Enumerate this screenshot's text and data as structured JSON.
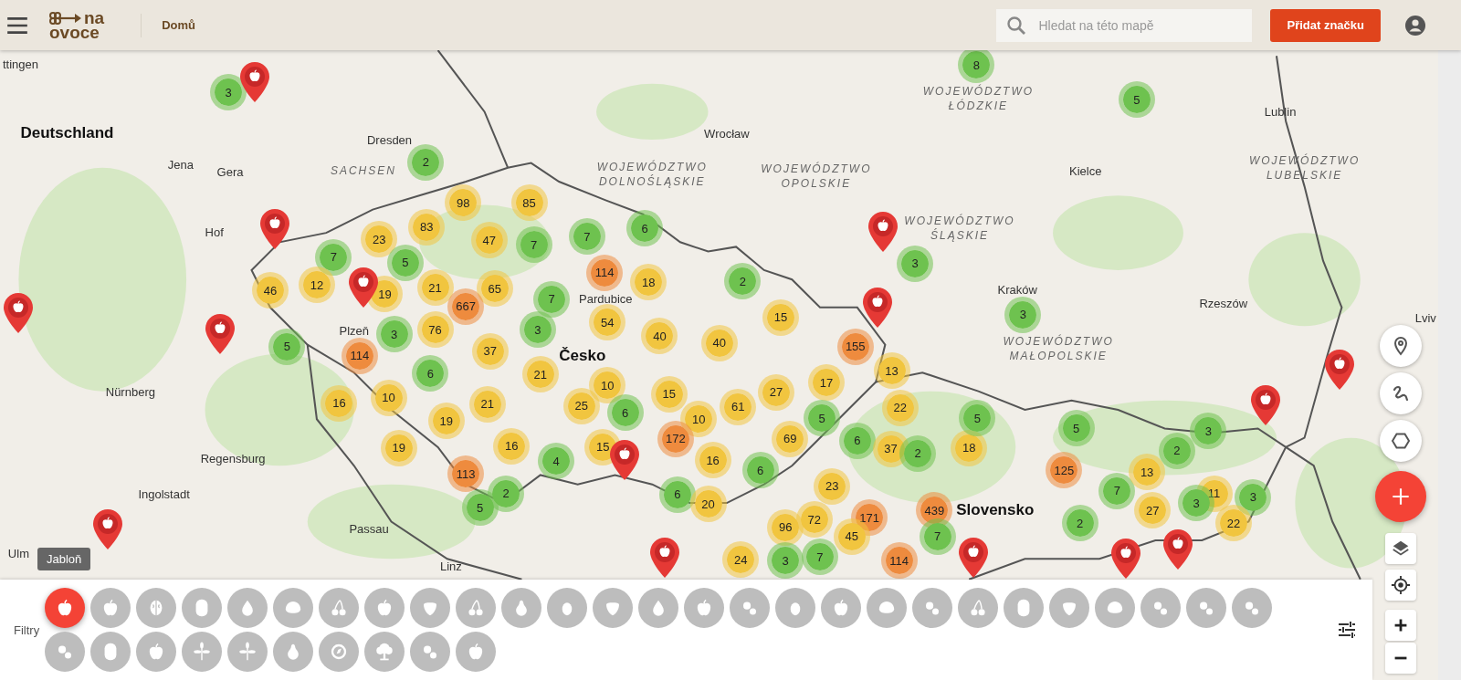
{
  "header": {
    "logo_lines": [
      "na",
      "ovoce"
    ],
    "nav_link": "Domů",
    "search": {
      "placeholder": "Hledat na této mapě"
    },
    "add_button": "Přidat značku"
  },
  "places": [
    {
      "name": "ttingen",
      "kind": "city"
    },
    {
      "name": "Deutschland",
      "kind": "country"
    },
    {
      "name": "Jena",
      "kind": "city"
    },
    {
      "name": "Gera",
      "kind": "city"
    },
    {
      "name": "Dresden",
      "kind": "city"
    },
    {
      "name": "SACHSEN",
      "kind": "region"
    },
    {
      "name": "Hof",
      "kind": "city"
    },
    {
      "name": "Nürnberg",
      "kind": "city"
    },
    {
      "name": "Regensburg",
      "kind": "city"
    },
    {
      "name": "Ingolstadt",
      "kind": "city"
    },
    {
      "name": "Passau",
      "kind": "city"
    },
    {
      "name": "Linz",
      "kind": "city"
    },
    {
      "name": "Ulm",
      "kind": "city"
    },
    {
      "name": "Wrocław",
      "kind": "city"
    },
    {
      "name": "WOJEWÓDZTWO DOLNOŚLĄSKIE",
      "kind": "region"
    },
    {
      "name": "WOJEWÓDZTWO OPOLSKIE",
      "kind": "region"
    },
    {
      "name": "WOJEWÓDZTWO ŁÓDZKIE",
      "kind": "region"
    },
    {
      "name": "WOJEWÓDZTWO ŚLĄSKIE",
      "kind": "region"
    },
    {
      "name": "Kraków",
      "kind": "city"
    },
    {
      "name": "Kielce",
      "kind": "city"
    },
    {
      "name": "Lublin",
      "kind": "city"
    },
    {
      "name": "WOJEWÓDZTWO LUBELSKIE",
      "kind": "region"
    },
    {
      "name": "Rzeszów",
      "kind": "city"
    },
    {
      "name": "WOJEWÓDZTWO MAŁOPOLSKIE",
      "kind": "region"
    },
    {
      "name": "Lviv",
      "kind": "city"
    },
    {
      "name": "Pardubice",
      "kind": "city"
    },
    {
      "name": "Česko",
      "kind": "country"
    },
    {
      "name": "Plzeň",
      "kind": "city"
    },
    {
      "name": "Slovensko",
      "kind": "country"
    }
  ],
  "clusters": [
    {
      "count": "8",
      "color": "#6ec24f"
    },
    {
      "count": "5",
      "color": "#6ec24f"
    },
    {
      "count": "3",
      "color": "#6ec24f"
    },
    {
      "count": "2",
      "color": "#6ec24f"
    },
    {
      "count": "98",
      "color": "#f1c53f"
    },
    {
      "count": "85",
      "color": "#f1c53f"
    },
    {
      "count": "23",
      "color": "#f1c53f"
    },
    {
      "count": "83",
      "color": "#f1c53f"
    },
    {
      "count": "47",
      "color": "#f1c53f"
    },
    {
      "count": "7",
      "color": "#6ec24f"
    },
    {
      "count": "7",
      "color": "#6ec24f"
    },
    {
      "count": "6",
      "color": "#6ec24f"
    },
    {
      "count": "7",
      "color": "#6ec24f"
    },
    {
      "count": "5",
      "color": "#6ec24f"
    },
    {
      "count": "46",
      "color": "#f1c53f"
    },
    {
      "count": "12",
      "color": "#f1c53f"
    },
    {
      "count": "19",
      "color": "#f1c53f"
    },
    {
      "count": "21",
      "color": "#f1c53f"
    },
    {
      "count": "65",
      "color": "#f1c53f"
    },
    {
      "count": "667",
      "color": "#ee8b3e"
    },
    {
      "count": "114",
      "color": "#ee8b3e"
    },
    {
      "count": "18",
      "color": "#f1c53f"
    },
    {
      "count": "2",
      "color": "#6ec24f"
    },
    {
      "count": "7",
      "color": "#6ec24f"
    },
    {
      "count": "3",
      "color": "#6ec24f"
    },
    {
      "count": "76",
      "color": "#f1c53f"
    },
    {
      "count": "3",
      "color": "#6ec24f"
    },
    {
      "count": "54",
      "color": "#f1c53f"
    },
    {
      "count": "40",
      "color": "#f1c53f"
    },
    {
      "count": "40",
      "color": "#f1c53f"
    },
    {
      "count": "15",
      "color": "#f1c53f"
    },
    {
      "count": "5",
      "color": "#6ec24f"
    },
    {
      "count": "114",
      "color": "#ee8b3e"
    },
    {
      "count": "37",
      "color": "#f1c53f"
    },
    {
      "count": "21",
      "color": "#f1c53f"
    },
    {
      "count": "10",
      "color": "#f1c53f"
    },
    {
      "count": "6",
      "color": "#6ec24f"
    },
    {
      "count": "155",
      "color": "#ee8b3e"
    },
    {
      "count": "13",
      "color": "#f1c53f"
    },
    {
      "count": "3",
      "color": "#6ec24f"
    },
    {
      "count": "3",
      "color": "#6ec24f"
    },
    {
      "count": "16",
      "color": "#f1c53f"
    },
    {
      "count": "10",
      "color": "#f1c53f"
    },
    {
      "count": "21",
      "color": "#f1c53f"
    },
    {
      "count": "25",
      "color": "#f1c53f"
    },
    {
      "count": "6",
      "color": "#6ec24f"
    },
    {
      "count": "15",
      "color": "#f1c53f"
    },
    {
      "count": "10",
      "color": "#f1c53f"
    },
    {
      "count": "61",
      "color": "#f1c53f"
    },
    {
      "count": "27",
      "color": "#f1c53f"
    },
    {
      "count": "17",
      "color": "#f1c53f"
    },
    {
      "count": "22",
      "color": "#f1c53f"
    },
    {
      "count": "19",
      "color": "#f1c53f"
    },
    {
      "count": "19",
      "color": "#f1c53f"
    },
    {
      "count": "16",
      "color": "#f1c53f"
    },
    {
      "count": "4",
      "color": "#6ec24f"
    },
    {
      "count": "15",
      "color": "#f1c53f"
    },
    {
      "count": "172",
      "color": "#ee8b3e"
    },
    {
      "count": "16",
      "color": "#f1c53f"
    },
    {
      "count": "69",
      "color": "#f1c53f"
    },
    {
      "count": "5",
      "color": "#6ec24f"
    },
    {
      "count": "6",
      "color": "#6ec24f"
    },
    {
      "count": "37",
      "color": "#f1c53f"
    },
    {
      "count": "2",
      "color": "#6ec24f"
    },
    {
      "count": "18",
      "color": "#f1c53f"
    },
    {
      "count": "5",
      "color": "#6ec24f"
    },
    {
      "count": "5",
      "color": "#6ec24f"
    },
    {
      "count": "125",
      "color": "#ee8b3e"
    },
    {
      "count": "7",
      "color": "#6ec24f"
    },
    {
      "count": "13",
      "color": "#f1c53f"
    },
    {
      "count": "2",
      "color": "#6ec24f"
    },
    {
      "count": "3",
      "color": "#6ec24f"
    },
    {
      "count": "11",
      "color": "#f1c53f"
    },
    {
      "count": "3",
      "color": "#6ec24f"
    },
    {
      "count": "27",
      "color": "#f1c53f"
    },
    {
      "count": "3",
      "color": "#6ec24f"
    },
    {
      "count": "2",
      "color": "#6ec24f"
    },
    {
      "count": "22",
      "color": "#f1c53f"
    },
    {
      "count": "113",
      "color": "#ee8b3e"
    },
    {
      "count": "2",
      "color": "#6ec24f"
    },
    {
      "count": "5",
      "color": "#6ec24f"
    },
    {
      "count": "6",
      "color": "#6ec24f"
    },
    {
      "count": "20",
      "color": "#f1c53f"
    },
    {
      "count": "6",
      "color": "#6ec24f"
    },
    {
      "count": "23",
      "color": "#f1c53f"
    },
    {
      "count": "171",
      "color": "#ee8b3e"
    },
    {
      "count": "439",
      "color": "#ee8b3e"
    },
    {
      "count": "7",
      "color": "#6ec24f"
    },
    {
      "count": "96",
      "color": "#f1c53f"
    },
    {
      "count": "72",
      "color": "#f1c53f"
    },
    {
      "count": "45",
      "color": "#f1c53f"
    },
    {
      "count": "24",
      "color": "#f1c53f"
    },
    {
      "count": "3",
      "color": "#6ec24f"
    },
    {
      "count": "7",
      "color": "#6ec24f"
    },
    {
      "count": "114",
      "color": "#ee8b3e"
    }
  ],
  "filters": {
    "label": "Filtry",
    "tooltip": "Jabloň",
    "items": [
      {
        "kind": "apple",
        "selected": true
      },
      {
        "kind": "apple",
        "selected": false
      },
      {
        "kind": "walnut",
        "selected": false
      },
      {
        "kind": "pod",
        "selected": false
      },
      {
        "kind": "drop",
        "selected": false
      },
      {
        "kind": "chestnut",
        "selected": false
      },
      {
        "kind": "cherry",
        "selected": false
      },
      {
        "kind": "apple",
        "selected": false
      },
      {
        "kind": "strawberry",
        "selected": false
      },
      {
        "kind": "cherry",
        "selected": false
      },
      {
        "kind": "pear",
        "selected": false
      },
      {
        "kind": "plum",
        "selected": false
      },
      {
        "kind": "strawberry",
        "selected": false
      },
      {
        "kind": "drop",
        "selected": false
      },
      {
        "kind": "apple",
        "selected": false
      },
      {
        "kind": "berries",
        "selected": false
      },
      {
        "kind": "plum",
        "selected": false
      },
      {
        "kind": "apple",
        "selected": false
      },
      {
        "kind": "chestnut",
        "selected": false
      },
      {
        "kind": "berries",
        "selected": false
      },
      {
        "kind": "cherry",
        "selected": false
      },
      {
        "kind": "pod",
        "selected": false
      },
      {
        "kind": "strawberry",
        "selected": false
      },
      {
        "kind": "chestnut",
        "selected": false
      },
      {
        "kind": "berries",
        "selected": false
      },
      {
        "kind": "berries",
        "selected": false
      },
      {
        "kind": "berries",
        "selected": false
      },
      {
        "kind": "berries",
        "selected": false
      },
      {
        "kind": "pod",
        "selected": false
      },
      {
        "kind": "apple",
        "selected": false
      },
      {
        "kind": "herb",
        "selected": false
      },
      {
        "kind": "herb",
        "selected": false
      },
      {
        "kind": "pear",
        "selected": false
      },
      {
        "kind": "ring",
        "selected": false
      },
      {
        "kind": "tree",
        "selected": false
      },
      {
        "kind": "berries",
        "selected": false
      },
      {
        "kind": "apple",
        "selected": false
      }
    ]
  }
}
